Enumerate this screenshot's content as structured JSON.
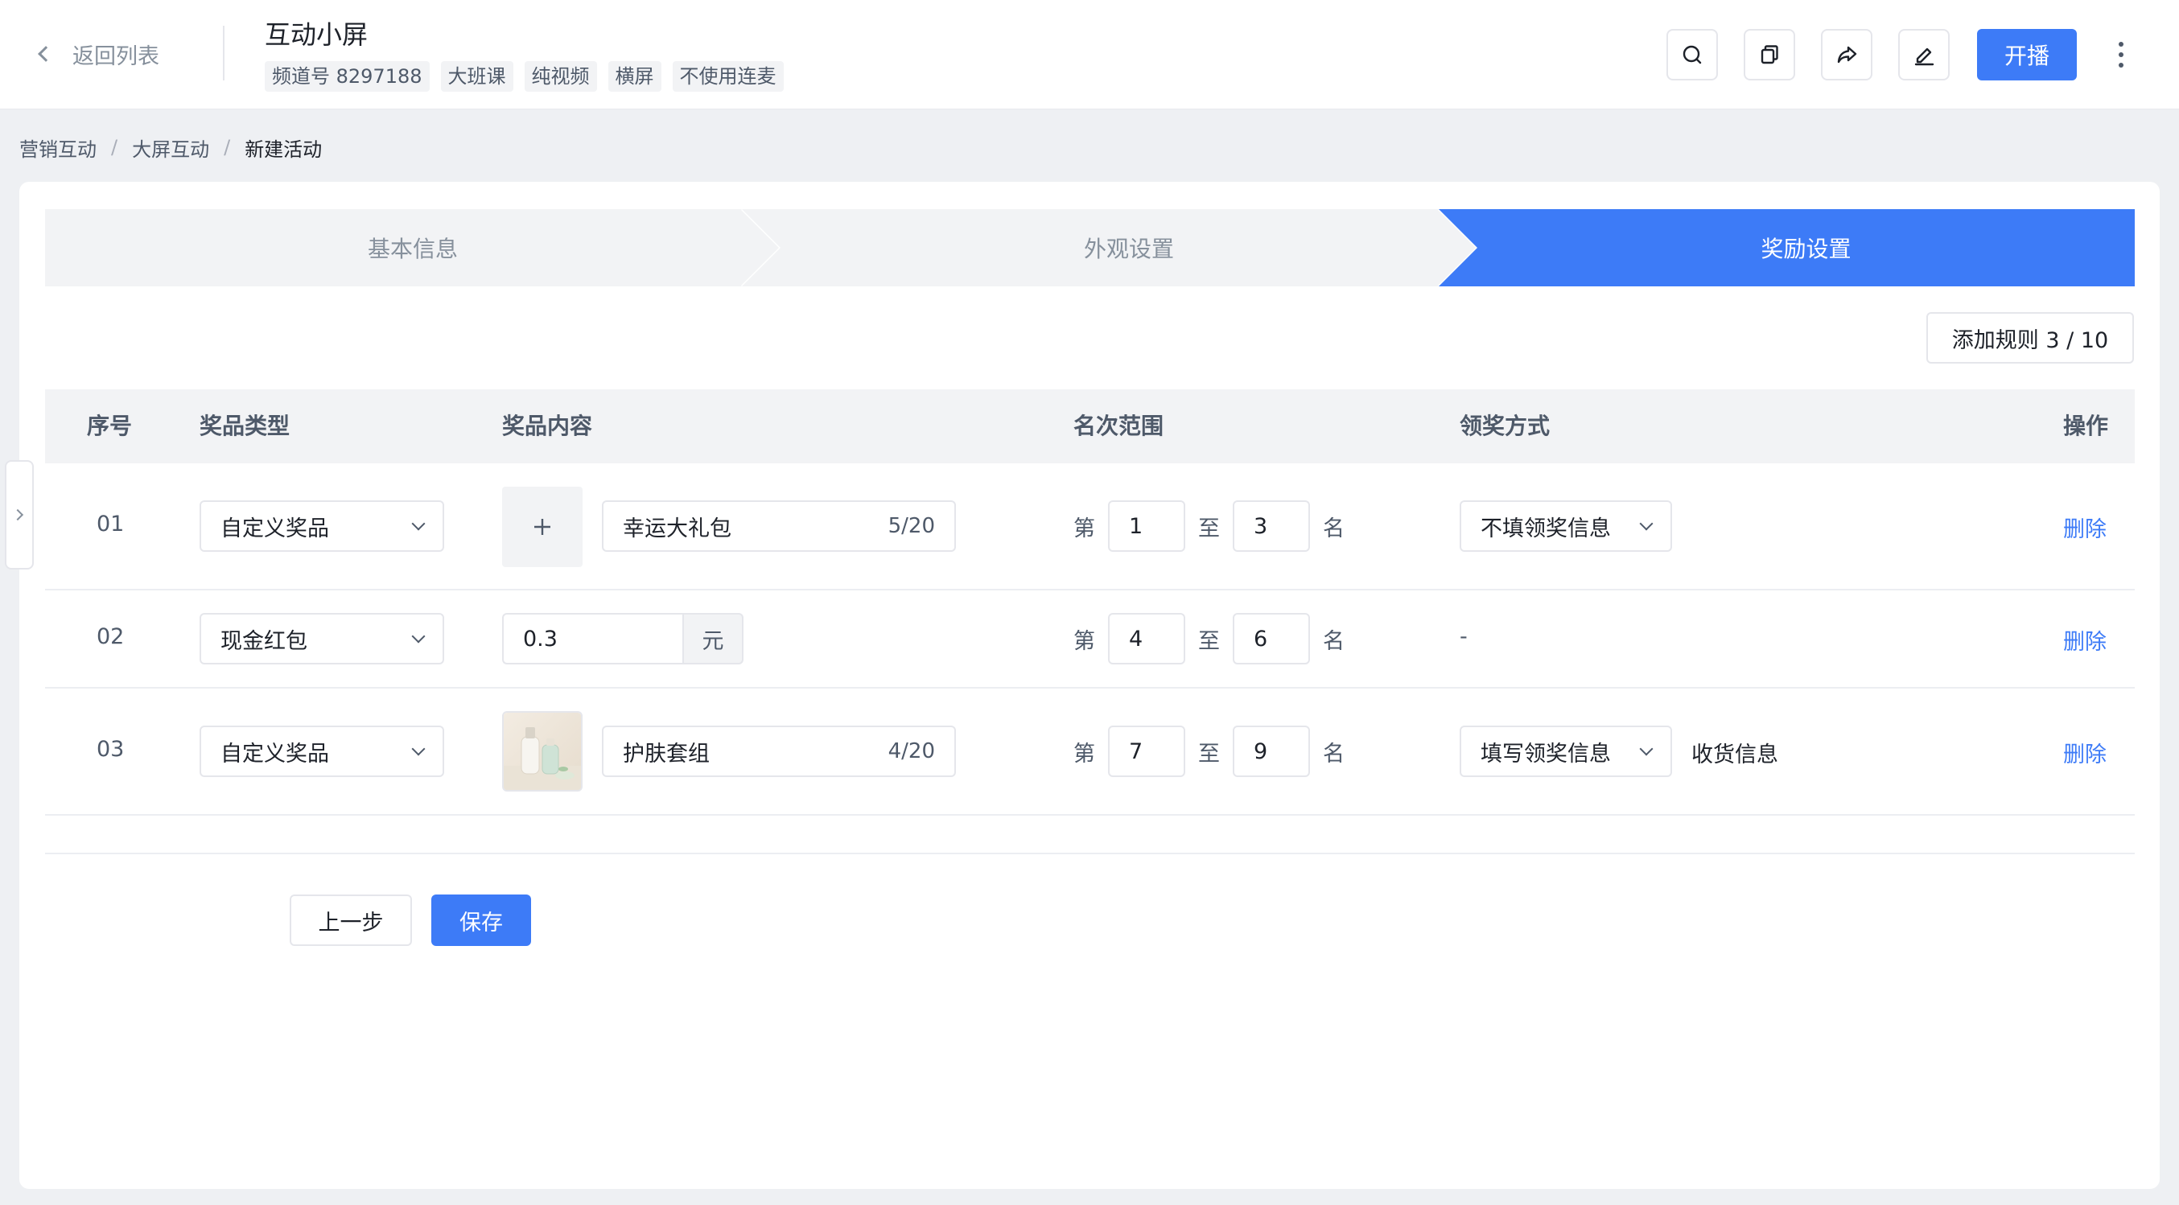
{
  "header": {
    "back_label": "返回列表",
    "title": "互动小屏",
    "tags": [
      "频道号 8297188",
      "大班课",
      "纯视频",
      "横屏",
      "不使用连麦"
    ],
    "actions": [
      "search-icon",
      "copy-icon",
      "share-icon",
      "edit-icon"
    ],
    "live_label": "开播",
    "brand_color": "#3d7bf7"
  },
  "breadcrumb": [
    "营销互动",
    "大屏互动",
    "新建活动"
  ],
  "steps": {
    "items": [
      "基本信息",
      "外观设置",
      "奖励设置"
    ],
    "active": 2
  },
  "add_rule_label": "添加规则 3 / 10",
  "table": {
    "headers": {
      "seq": "序号",
      "type": "奖品类型",
      "content": "奖品内容",
      "range": "名次范围",
      "method": "领奖方式",
      "action": "操作"
    },
    "rank_prefix": "第",
    "rank_mid": "至",
    "rank_suffix": "名",
    "delete_label": "删除",
    "rows": [
      {
        "seq": "01",
        "type": "自定义奖品",
        "image": "plus-icon",
        "name": "幸运大礼包",
        "count": "5/20",
        "from": "1",
        "to": "3",
        "method": "不填领奖信息",
        "method_extra": ""
      },
      {
        "seq": "02",
        "type": "现金红包",
        "amount": "0.3",
        "unit": "元",
        "from": "4",
        "to": "6",
        "method": "-"
      },
      {
        "seq": "03",
        "type": "自定义奖品",
        "image": "skincare-product-photo",
        "name": "护肤套组",
        "count": "4/20",
        "from": "7",
        "to": "9",
        "method": "填写领奖信息",
        "method_extra": "收货信息"
      }
    ]
  },
  "footer": {
    "prev_label": "上一步",
    "save_label": "保存"
  }
}
